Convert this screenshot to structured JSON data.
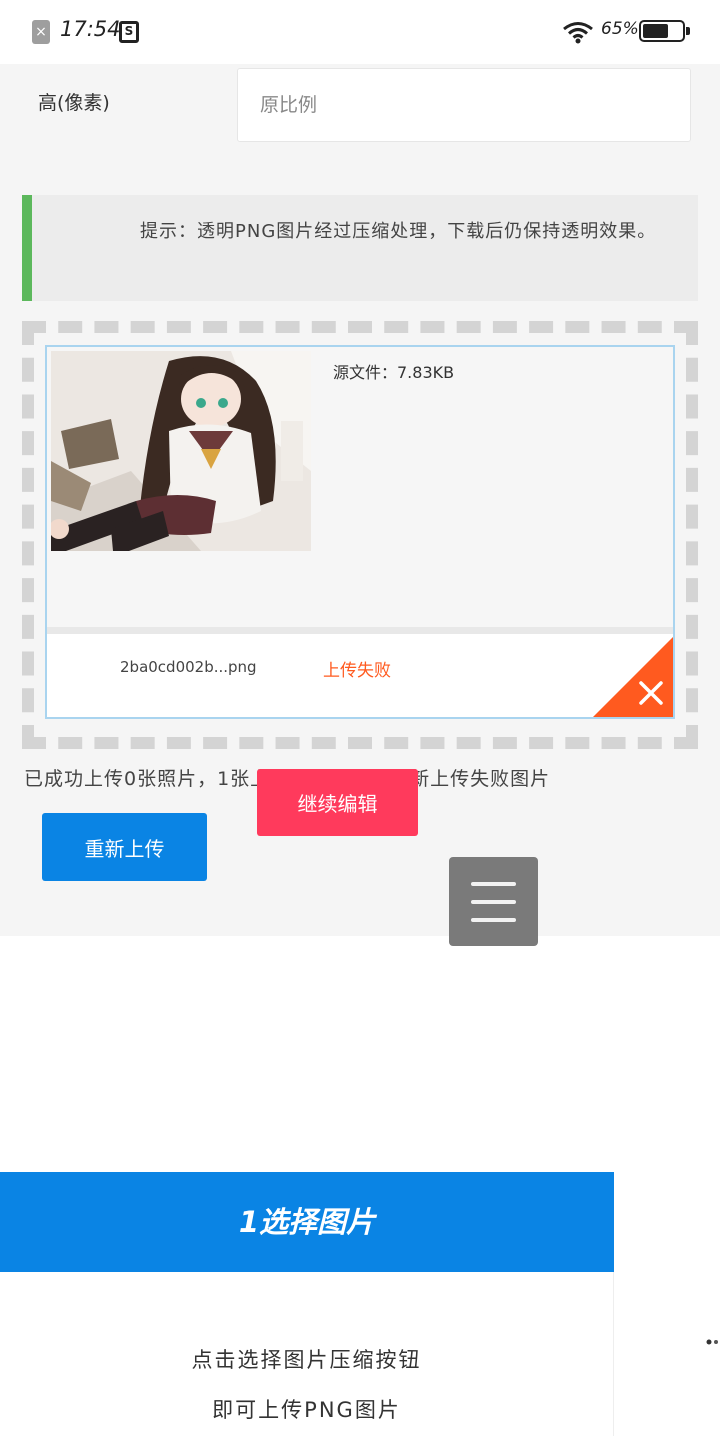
{
  "status_bar": {
    "time": "17:54",
    "battery_pct": "65%",
    "battery_level": 0.65,
    "sim_icon": "sim-error-icon",
    "screenshot_icon": "screenshot-icon",
    "screenshot_glyph": "S",
    "wifi_icon": "wifi-icon"
  },
  "form": {
    "height_label": "高(像素)",
    "height_placeholder": "原比例"
  },
  "tip": {
    "text": "提示：透明PNG图片经过压缩处理，下载后仍保持透明效果。",
    "accent_color": "#5cb85c"
  },
  "upload_item": {
    "source_size": "源文件：7.83KB",
    "file_name": "2ba0cd002b...png",
    "status": "上传失败",
    "status_color": "#ff5a1f",
    "remove_icon": "close-icon"
  },
  "summary": {
    "text": "已成功上传0张照片，1张上传失败，点击重新上传失败图片"
  },
  "buttons": {
    "reupload": "重新上传",
    "continue_edit": "继续编辑",
    "menu_icon": "hamburger-menu-icon"
  },
  "step": {
    "title": "1选择图片",
    "line1": "点击选择图片压缩按钮",
    "line2": "即可上传PNG图片"
  },
  "colors": {
    "primary_blue": "#0a84e4",
    "accent_red": "#ff3a5c",
    "error_orange": "#ff5a1f"
  }
}
